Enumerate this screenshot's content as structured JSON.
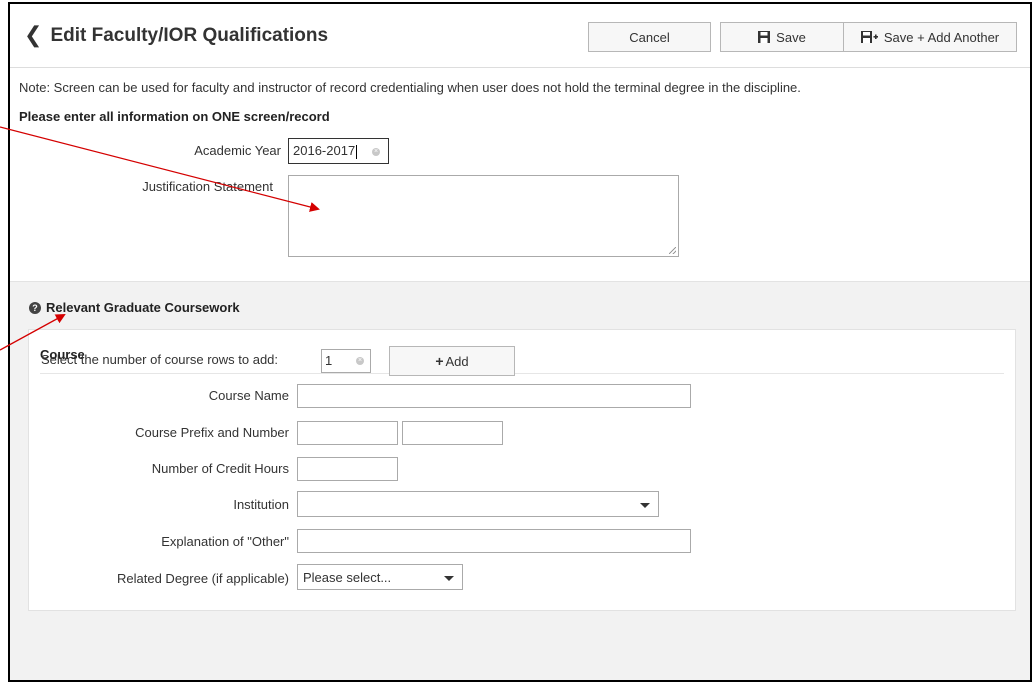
{
  "header": {
    "title": "Edit Faculty/IOR Qualifications",
    "cancel_label": "Cancel",
    "save_label": "Save",
    "save_add_label": "Save + Add Another"
  },
  "notes": {
    "note": "Note: Screen can be used for faculty and instructor of record credentialing when user does not hold the terminal degree in the discipline.",
    "instruction": "Please enter all information on ONE screen/record"
  },
  "form": {
    "academic_year_label": "Academic Year",
    "academic_year_value": "2016-2017",
    "justification_label": "Justification Statement",
    "justification_value": ""
  },
  "coursework": {
    "section_title": "Relevant Graduate Coursework",
    "panel_title": "Course",
    "course_name_label": "Course Name",
    "course_name_value": "",
    "prefix_number_label": "Course Prefix and Number",
    "prefix_value": "",
    "number_value": "",
    "credit_hours_label": "Number of Credit Hours",
    "credit_hours_value": "",
    "institution_label": "Institution",
    "institution_value": "",
    "other_label": "Explanation of \"Other\"",
    "other_value": "",
    "related_degree_label": "Related Degree (if applicable)",
    "related_degree_value": "Please select...",
    "rows_label": "Select the number of course rows to add:",
    "rows_value": "1",
    "add_label": "Add"
  },
  "colors": {
    "annotation_arrow": "#d40000",
    "section_bg": "#f2f2f2"
  }
}
